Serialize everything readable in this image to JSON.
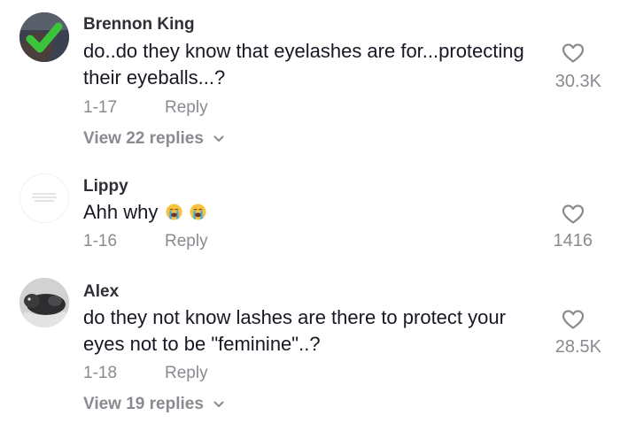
{
  "comments": [
    {
      "username": "Brennon King",
      "text": "do..do they know that eyelashes are for...protecting their eyeballs...?",
      "date": "1-17",
      "reply_label": "Reply",
      "likes": "30.3K",
      "view_replies": "View 22 replies",
      "avatar_icon": "green-checkmark-avatar"
    },
    {
      "username": "Lippy",
      "text": "Ahh why",
      "emoji": "loudly-crying-face x2",
      "date": "1-16",
      "reply_label": "Reply",
      "likes": "1416",
      "avatar_icon": "white-text-avatar"
    },
    {
      "username": "Alex",
      "text": "do they not know lashes are there to protect your eyes not to be \"feminine\"..?",
      "date": "1-18",
      "reply_label": "Reply",
      "likes": "28.5K",
      "view_replies": "View 19 replies",
      "avatar_icon": "dark-animal-photo-avatar"
    }
  ],
  "colors": {
    "text": "#161823",
    "username": "#2f2f36",
    "muted": "#8a8b91",
    "checkmark": "#3cc33c"
  }
}
